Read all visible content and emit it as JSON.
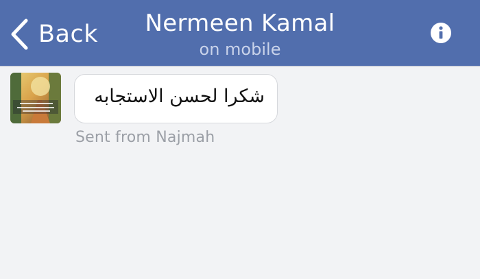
{
  "header": {
    "back_label": "Back",
    "title": "Nermeen Kamal",
    "subtitle": "on mobile",
    "info_icon": "info-icon",
    "bar_color": "#516ead"
  },
  "conversation": {
    "messages": [
      {
        "text": "شكرا لحسن الاستجابه",
        "footer": "Sent from Najmah",
        "avatar": "contact-avatar"
      }
    ]
  }
}
